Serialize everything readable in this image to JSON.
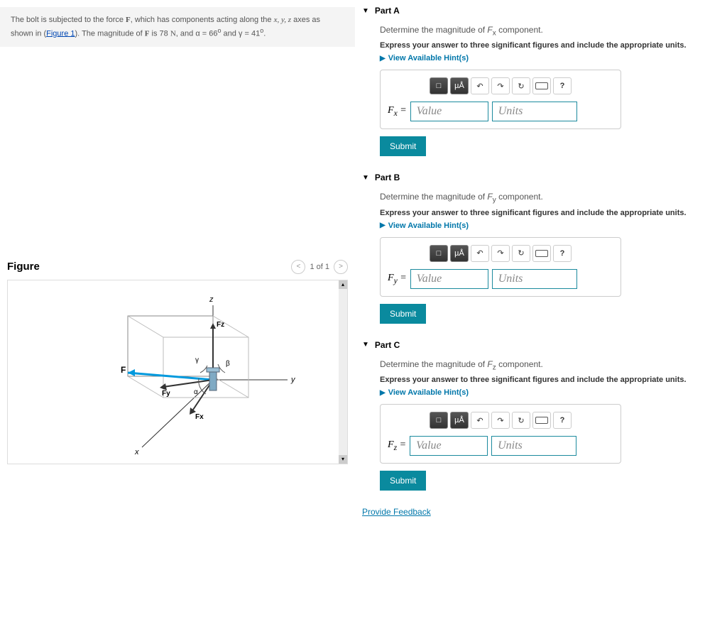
{
  "problem": {
    "text_before_link": "The bolt is subjected to the force ",
    "force_symbol": "F",
    "text_mid1": ", which has components acting along the ",
    "axes": "x, y, z",
    "text_mid2": " axes as shown in (",
    "link_text": "Figure 1",
    "text_mid3": "). The magnitude of ",
    "text_mid4": " is 78 ",
    "unit_N": "N",
    "text_mid5": ", and α = 66",
    "deg_symbol": "o",
    "text_mid6": " and γ = 41",
    "text_end": "."
  },
  "figure": {
    "title": "Figure",
    "counter": "1 of 1",
    "labels": {
      "x": "x",
      "y": "y",
      "z": "z",
      "F": "F",
      "Fx": "Fx",
      "Fy": "Fy",
      "Fz": "Fz",
      "alpha": "α",
      "beta": "β",
      "gamma": "γ"
    }
  },
  "parts": [
    {
      "title": "Part A",
      "question": "Determine the magnitude of Fx component.",
      "instruction": "Express your answer to three significant figures and include the appropriate units.",
      "hints_label": "View Available Hint(s)",
      "input_label": "Fx =",
      "value_placeholder": "Value",
      "units_placeholder": "Units",
      "submit": "Submit"
    },
    {
      "title": "Part B",
      "question": "Determine the magnitude of Fy component.",
      "instruction": "Express your answer to three significant figures and include the appropriate units.",
      "hints_label": "View Available Hint(s)",
      "input_label": "Fy =",
      "value_placeholder": "Value",
      "units_placeholder": "Units",
      "submit": "Submit"
    },
    {
      "title": "Part C",
      "question": "Determine the magnitude of Fz component.",
      "instruction": "Express your answer to three significant figures and include the appropriate units.",
      "hints_label": "View Available Hint(s)",
      "input_label": "Fz =",
      "value_placeholder": "Value",
      "units_placeholder": "Units",
      "submit": "Submit"
    }
  ],
  "toolbar": {
    "fraction": "□",
    "microA": "µÅ",
    "undo": "↶",
    "redo": "↷",
    "reset": "↻",
    "help": "?"
  },
  "feedback": "Provide Feedback"
}
